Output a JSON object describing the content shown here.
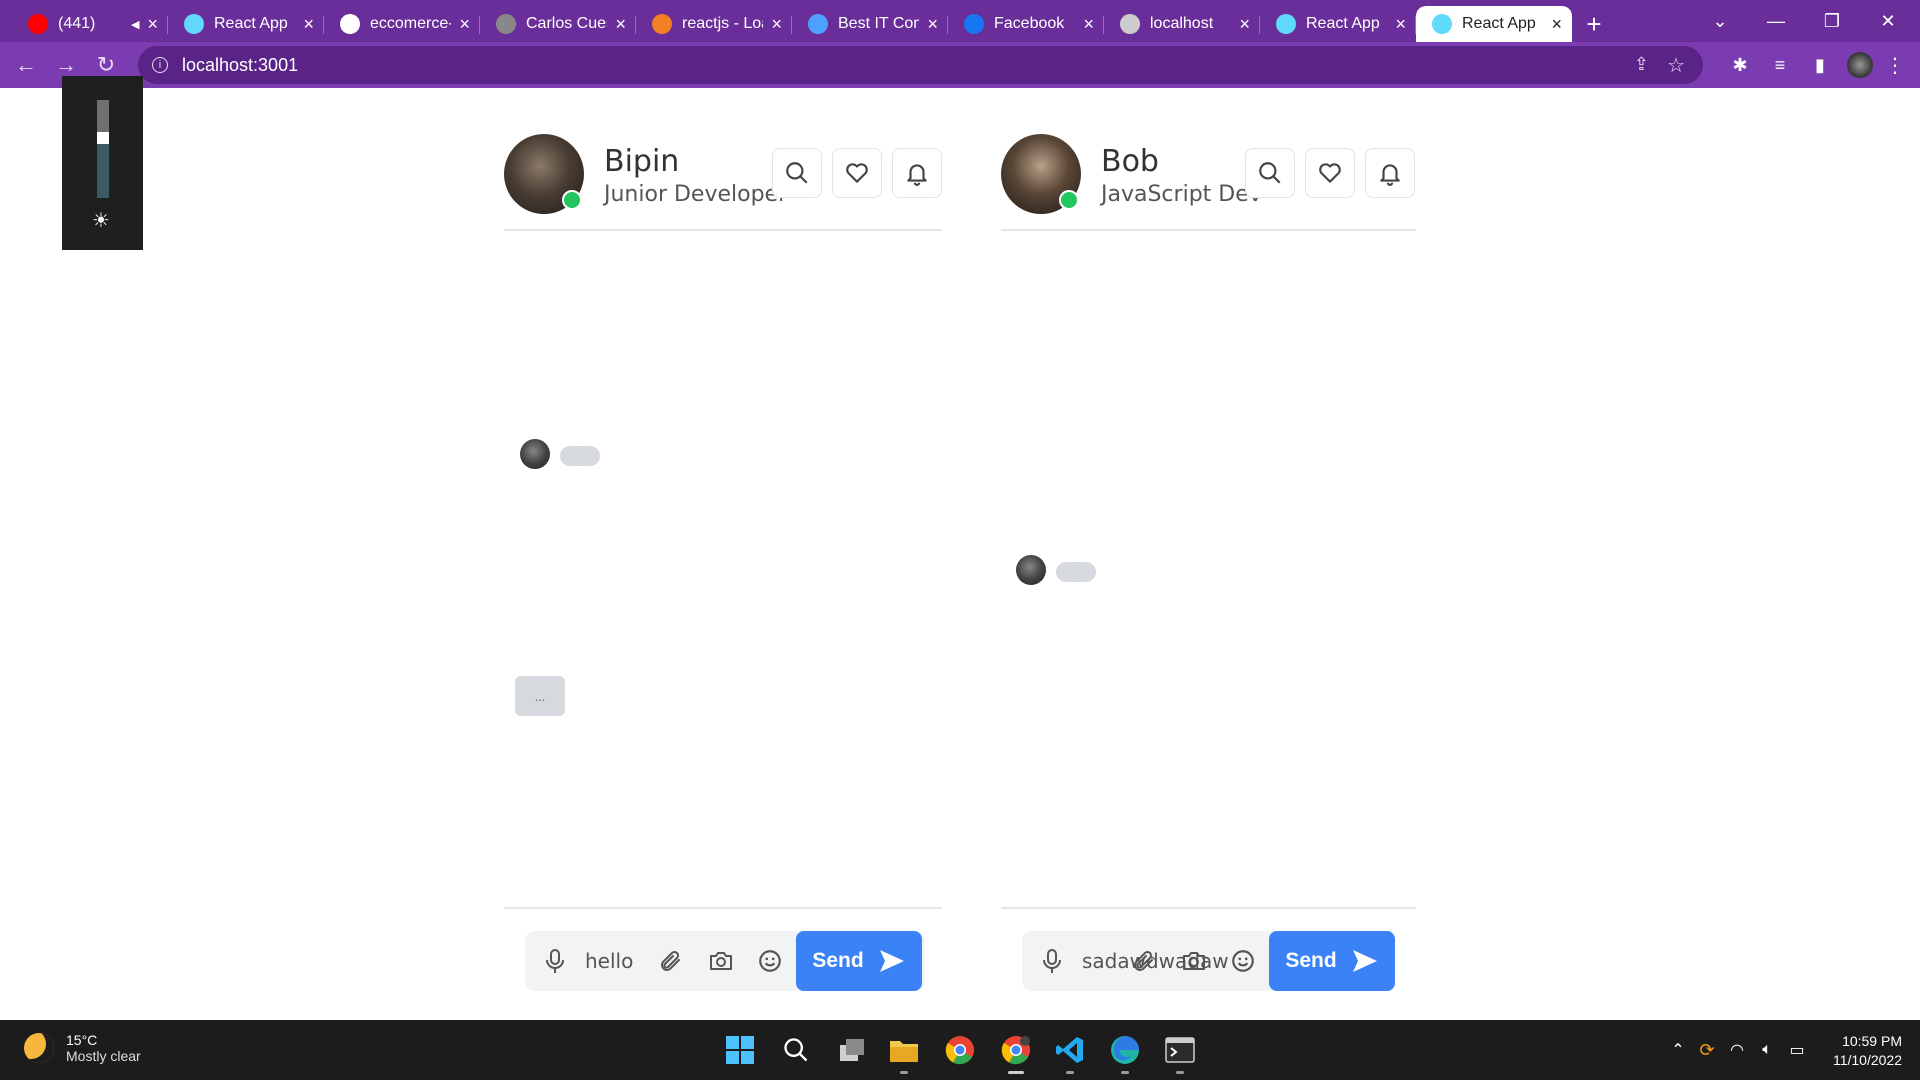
{
  "browser": {
    "tabs": [
      {
        "label": "(441)",
        "icon": "youtube-icon",
        "color": "#ff0000",
        "extra": "muted"
      },
      {
        "label": "React App",
        "icon": "react-icon",
        "color": "#61dafb"
      },
      {
        "label": "eccomerce-",
        "icon": "github-icon",
        "color": "#ffffff"
      },
      {
        "label": "Carlos Cues",
        "icon": "profile-icon",
        "color": "#888888"
      },
      {
        "label": "reactjs - Loa",
        "icon": "stackoverflow-icon",
        "color": "#f48024"
      },
      {
        "label": "Best IT Com",
        "icon": "site-icon",
        "color": "#4ea0ff"
      },
      {
        "label": "Facebook",
        "icon": "facebook-icon",
        "color": "#1877f2"
      },
      {
        "label": "localhost",
        "icon": "globe-icon",
        "color": "#cccccc"
      },
      {
        "label": "React App",
        "icon": "react-icon",
        "color": "#61dafb"
      },
      {
        "label": "React App",
        "icon": "react-icon",
        "color": "#61dafb",
        "active": true
      }
    ],
    "url": "localhost:3001"
  },
  "panels": [
    {
      "user_name": "Bipin",
      "user_title": "Junior Developer",
      "typing": "...",
      "composer_text": "hello",
      "send_label": "Send"
    },
    {
      "user_name": "Bob",
      "user_title": "JavaScript Dev",
      "composer_text": "sadawdwadaw",
      "send_label": "Send"
    }
  ],
  "taskbar": {
    "temperature": "15°C",
    "weather": "Mostly clear",
    "time": "10:59 PM",
    "date": "11/10/2022"
  },
  "colors": {
    "browser_frame": "#6a2e9a",
    "send_button": "#3b82f6",
    "online": "#22c55e"
  }
}
